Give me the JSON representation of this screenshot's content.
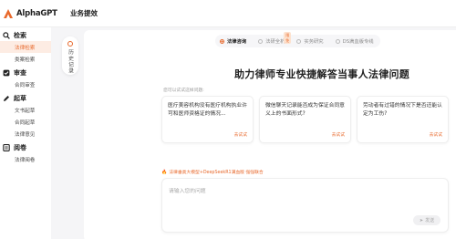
{
  "app": {
    "name": "AlphaGPT",
    "page_title": "业务提效"
  },
  "sidebar": {
    "sections": [
      {
        "label": "检索",
        "icon": "search-icon",
        "items": [
          {
            "label": "法律检索",
            "active": true
          },
          {
            "label": "类案检索",
            "active": false
          }
        ]
      },
      {
        "label": "审查",
        "icon": "review-icon",
        "items": [
          {
            "label": "合同审查",
            "active": false
          }
        ]
      },
      {
        "label": "起草",
        "icon": "draft-icon",
        "items": [
          {
            "label": "文书起草",
            "active": false
          },
          {
            "label": "合同起草",
            "active": false
          },
          {
            "label": "法律意见",
            "active": false
          }
        ]
      },
      {
        "label": "阅卷",
        "icon": "file-icon",
        "items": [
          {
            "label": "法律阅卷",
            "active": false
          }
        ]
      }
    ]
  },
  "history": {
    "label": "历史记录"
  },
  "tabs": [
    {
      "label": "法律咨询",
      "active": true,
      "badge": ""
    },
    {
      "label": "法研全析",
      "active": false,
      "badge": "限免"
    },
    {
      "label": "实务研究",
      "active": false,
      "badge": ""
    },
    {
      "label": "DS满血版专线",
      "active": false,
      "badge": ""
    }
  ],
  "headline": "助力律师专业快捷解答当事人法律问题",
  "try_label": "您可以试试这样问题:",
  "cards": [
    {
      "text": "医疗美容机构没有医疗机构执业许可和医师资格证的情况...",
      "button": "去试试"
    },
    {
      "text": "微信聊天记录能否成为保证合同意义上的书面形式?",
      "button": "去试试"
    },
    {
      "text": "劳动者有过错的情况下是否还能认定为工伤?",
      "button": "去试试"
    }
  ],
  "model": {
    "label": "法律垂类大模型+DeepSeekR1满血版 强强联合"
  },
  "input": {
    "placeholder": "请输入您的问题",
    "send_label": "发送"
  },
  "colors": {
    "accent": "#e8692c",
    "accent_light": "#fdece3"
  }
}
